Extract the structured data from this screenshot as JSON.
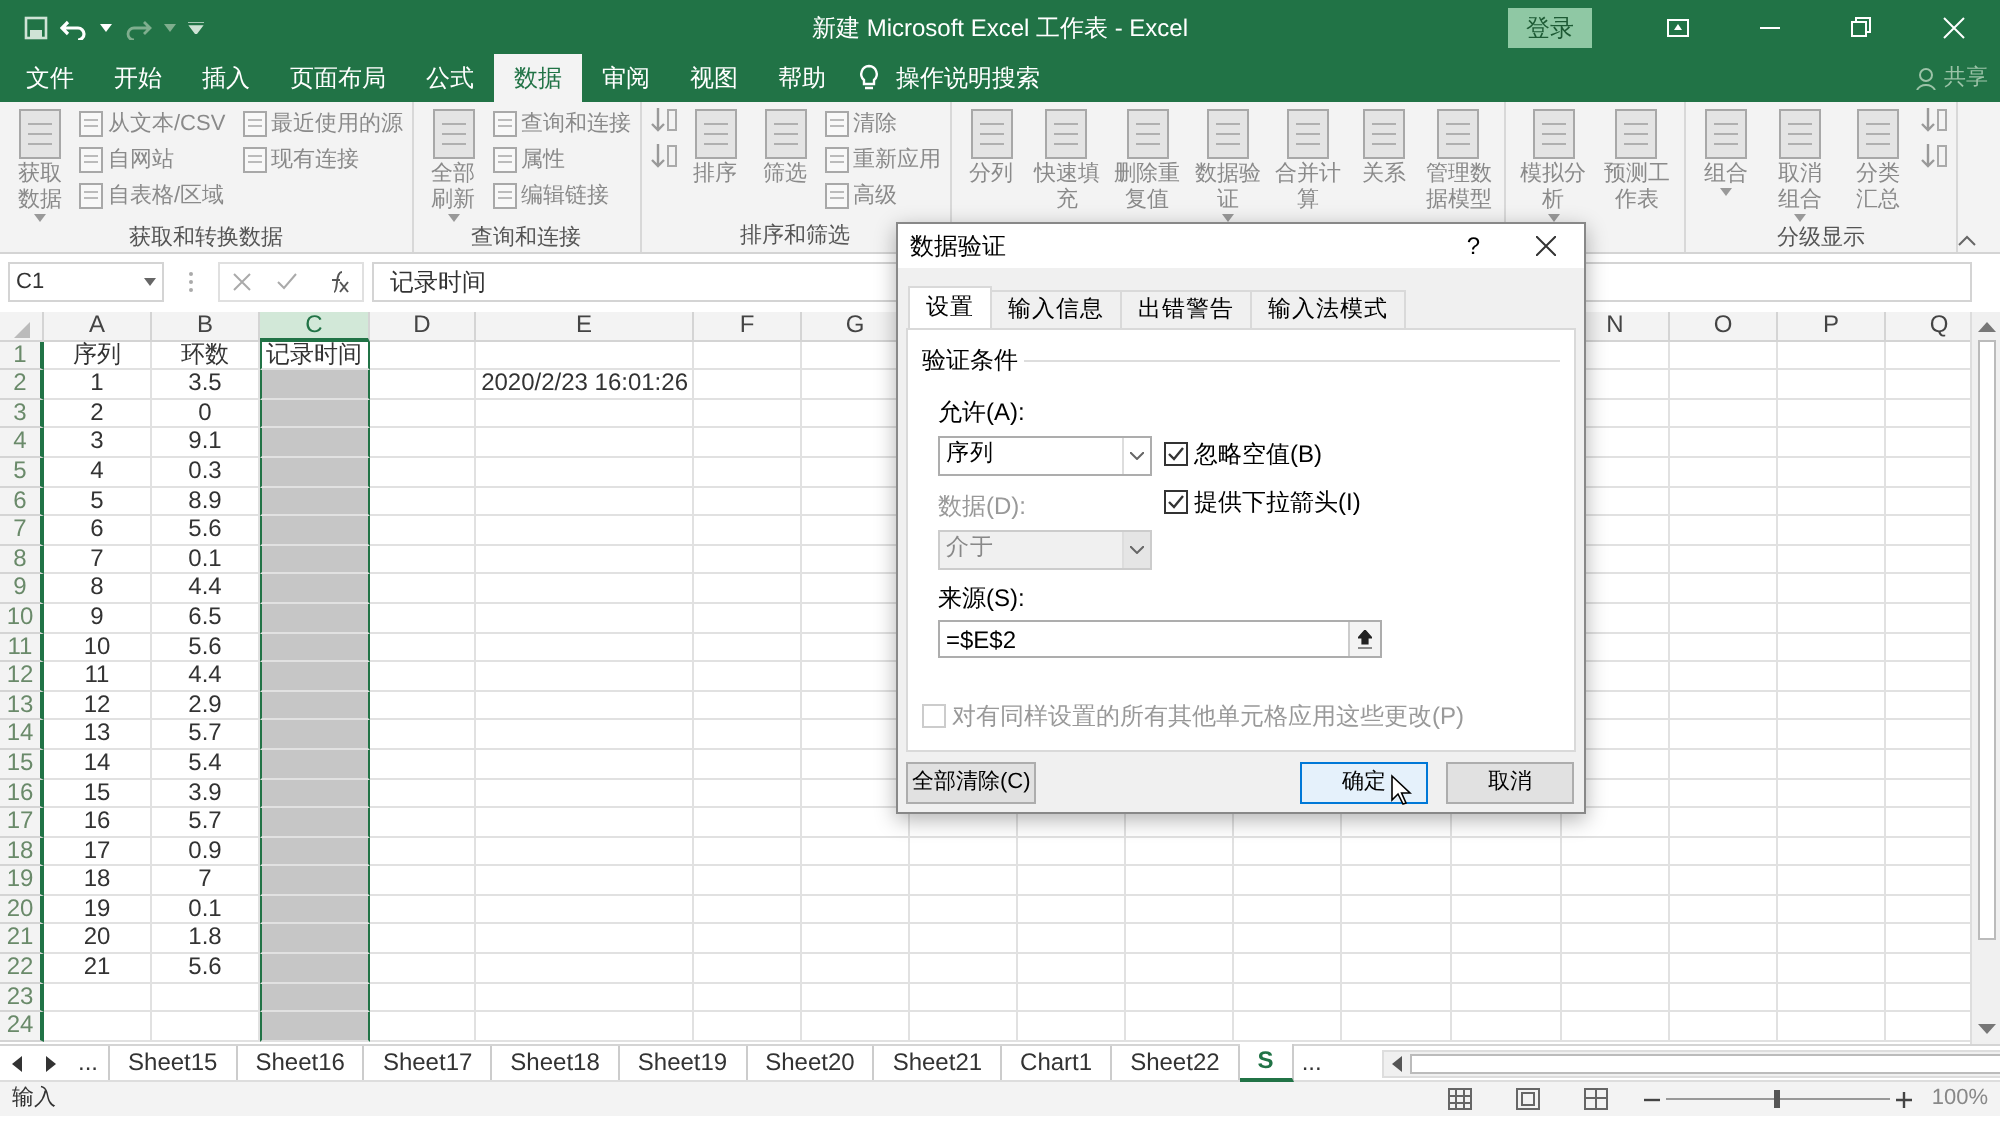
{
  "title_bar": {
    "title": "新建 Microsoft Excel 工作表 - Excel",
    "sign_in": "登录"
  },
  "menu_tabs": [
    {
      "label": "文件",
      "selected": false
    },
    {
      "label": "开始",
      "selected": false
    },
    {
      "label": "插入",
      "selected": false
    },
    {
      "label": "页面布局",
      "selected": false
    },
    {
      "label": "公式",
      "selected": false
    },
    {
      "label": "数据",
      "selected": true
    },
    {
      "label": "审阅",
      "selected": false
    },
    {
      "label": "视图",
      "selected": false
    },
    {
      "label": "帮助",
      "selected": false
    }
  ],
  "tell_me": "操作说明搜索",
  "share": "共享",
  "ribbon": {
    "groups": [
      {
        "label": "获取和转换数据",
        "items": [
          {
            "kind": "large",
            "label": "获取数据",
            "dropdown": true
          },
          {
            "kind": "small",
            "label": "从文本/CSV"
          },
          {
            "kind": "small",
            "label": "自网站"
          },
          {
            "kind": "small",
            "label": "自表格/区域"
          },
          {
            "kind": "small",
            "label": "最近使用的源"
          },
          {
            "kind": "small",
            "label": "现有连接"
          }
        ]
      },
      {
        "label": "查询和连接",
        "items": [
          {
            "kind": "large",
            "label": "全部刷新",
            "dropdown": true
          },
          {
            "kind": "small",
            "label": "查询和连接"
          },
          {
            "kind": "small",
            "label": "属性"
          },
          {
            "kind": "small",
            "label": "编辑链接"
          }
        ]
      },
      {
        "label": "排序和筛选",
        "items": [
          {
            "kind": "icon"
          },
          {
            "kind": "icon"
          },
          {
            "kind": "large",
            "label": "排序",
            "dropdown": false
          },
          {
            "kind": "large",
            "label": "筛选",
            "dropdown": false
          },
          {
            "kind": "small",
            "label": "清除"
          },
          {
            "kind": "small",
            "label": "重新应用"
          },
          {
            "kind": "small",
            "label": "高级"
          }
        ]
      },
      {
        "items": [
          {
            "kind": "large",
            "label": "分列",
            "dropdown": false
          },
          {
            "kind": "large",
            "label": "快速填充",
            "dropdown": false
          },
          {
            "kind": "large",
            "label": "删除重复值",
            "dropdown": false
          },
          {
            "kind": "large",
            "label": "数据验证",
            "dropdown": true
          },
          {
            "kind": "large",
            "label": "合并计算",
            "dropdown": false
          },
          {
            "kind": "large",
            "label": "关系",
            "dropdown": false
          },
          {
            "kind": "large",
            "label": "管理数据模型",
            "dropdown": false
          }
        ]
      },
      {
        "items": [
          {
            "kind": "large",
            "label": "模拟分析",
            "dropdown": true
          },
          {
            "kind": "large",
            "label": "预测工作表",
            "dropdown": false
          }
        ]
      },
      {
        "label": "分级显示",
        "items": [
          {
            "kind": "large",
            "label": "组合",
            "dropdown": true
          },
          {
            "kind": "large",
            "label": "取消组合",
            "dropdown": true
          },
          {
            "kind": "large",
            "label": "分类汇总",
            "dropdown": false
          },
          {
            "kind": "icon"
          },
          {
            "kind": "icon"
          }
        ]
      }
    ]
  },
  "formula_bar": {
    "name_box": "C1",
    "formula": "记录时间"
  },
  "sheet": {
    "columns": [
      {
        "label": "A",
        "selected": false
      },
      {
        "label": "B",
        "selected": false
      },
      {
        "label": "C",
        "selected": true
      },
      {
        "label": "D",
        "selected": false
      },
      {
        "label": "E",
        "selected": false
      },
      {
        "label": "F",
        "selected": false
      },
      {
        "label": "G",
        "selected": false
      },
      {
        "label": "N",
        "selected": false
      },
      {
        "label": "O",
        "selected": false
      },
      {
        "label": "P",
        "selected": false
      },
      {
        "label": "Q",
        "selected": false
      }
    ],
    "rows": [
      {
        "label": "1",
        "col_a": "序列",
        "col_b": "环数",
        "col_c": "记录时间"
      },
      {
        "label": "2",
        "col_a": "1",
        "col_b": "3.5",
        "col_e": "2020/2/23 16:01:26"
      },
      {
        "label": "3",
        "col_a": "2",
        "col_b": "0"
      },
      {
        "label": "4",
        "col_a": "3",
        "col_b": "9.1"
      },
      {
        "label": "5",
        "col_a": "4",
        "col_b": "0.3"
      },
      {
        "label": "6",
        "col_a": "5",
        "col_b": "8.9"
      },
      {
        "label": "7",
        "col_a": "6",
        "col_b": "5.6"
      },
      {
        "label": "8",
        "col_a": "7",
        "col_b": "0.1"
      },
      {
        "label": "9",
        "col_a": "8",
        "col_b": "4.4"
      },
      {
        "label": "10",
        "col_a": "9",
        "col_b": "6.5"
      },
      {
        "label": "11",
        "col_a": "10",
        "col_b": "5.6"
      },
      {
        "label": "12",
        "col_a": "11",
        "col_b": "4.4"
      },
      {
        "label": "13",
        "col_a": "12",
        "col_b": "2.9"
      },
      {
        "label": "14",
        "col_a": "13",
        "col_b": "5.7"
      },
      {
        "label": "15",
        "col_a": "14",
        "col_b": "5.4"
      },
      {
        "label": "16",
        "col_a": "15",
        "col_b": "3.9"
      },
      {
        "label": "17",
        "col_a": "16",
        "col_b": "5.7"
      },
      {
        "label": "18",
        "col_a": "17",
        "col_b": "0.9"
      },
      {
        "label": "19",
        "col_a": "18",
        "col_b": "7"
      },
      {
        "label": "20",
        "col_a": "19",
        "col_b": "0.1"
      },
      {
        "label": "21",
        "col_a": "20",
        "col_b": "1.8"
      },
      {
        "label": "22",
        "col_a": "21",
        "col_b": "5.6"
      },
      {
        "label": "23"
      },
      {
        "label": "24"
      }
    ]
  },
  "sheet_tabs": {
    "overflow_left": "...",
    "tabs": [
      {
        "label": "Sheet15",
        "selected": false
      },
      {
        "label": "Sheet16",
        "selected": false
      },
      {
        "label": "Sheet17",
        "selected": false
      },
      {
        "label": "Sheet18",
        "selected": false
      },
      {
        "label": "Sheet19",
        "selected": false
      },
      {
        "label": "Sheet20",
        "selected": false
      },
      {
        "label": "Sheet21",
        "selected": false
      },
      {
        "label": "Chart1",
        "selected": false
      },
      {
        "label": "Sheet22",
        "selected": false
      },
      {
        "label": "S",
        "selected": true
      }
    ],
    "overflow_right": "..."
  },
  "status_bar": {
    "mode": "输入",
    "zoom": "100%",
    "level": 0.5
  },
  "dialog": {
    "title": "数据验证",
    "help": "?",
    "tabs": [
      {
        "label": "设置",
        "selected": true
      },
      {
        "label": "输入信息",
        "selected": false
      },
      {
        "label": "出错警告",
        "selected": false
      },
      {
        "label": "输入法模式",
        "selected": false
      }
    ],
    "section": "验证条件",
    "allow": {
      "label": "允许(A):",
      "value": "序列",
      "disabled": false
    },
    "data": {
      "label": "数据(D):",
      "value": "介于",
      "disabled": true
    },
    "ignore_blank": {
      "label": "忽略空值(B)",
      "checked": true,
      "disabled": false
    },
    "dropdown_arrow": {
      "label": "提供下拉箭头(I)",
      "checked": true,
      "disabled": false
    },
    "source": {
      "label": "来源(S):",
      "value": "=$E$2"
    },
    "apply_all": {
      "label": "对有同样设置的所有其他单元格应用这些更改(P)",
      "checked": false,
      "disabled": true
    },
    "buttons": [
      {
        "label": "全部清除(C)",
        "focused": false
      },
      {
        "label": "确定",
        "focused": true
      },
      {
        "label": "取消",
        "focused": false
      }
    ]
  }
}
